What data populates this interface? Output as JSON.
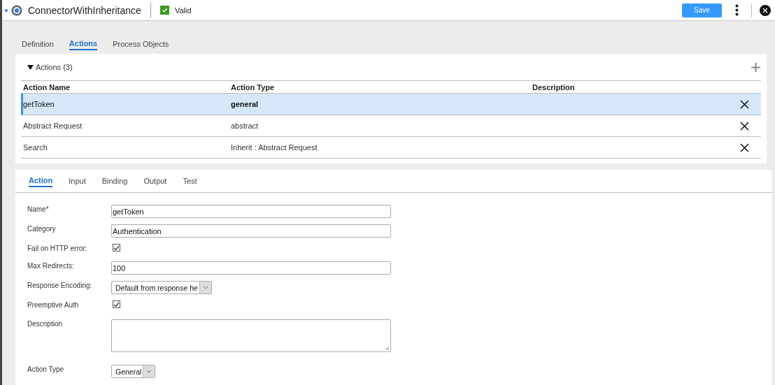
{
  "header": {
    "title": "ConnectorWithInheritance",
    "status": "Valid",
    "valid": true,
    "save": "Save"
  },
  "tabs": [
    {
      "label": "Definition",
      "selected": false
    },
    {
      "label": "Actions",
      "selected": true
    },
    {
      "label": "Process Objects",
      "selected": false
    }
  ],
  "actions": {
    "heading": "Actions (3)",
    "expanded": true,
    "columns": [
      "Action Name",
      "Action Type",
      "Description"
    ],
    "rows": [
      {
        "name": "getToken",
        "type": "general",
        "selected": true
      },
      {
        "name": "Abstract Request",
        "type": "abstract",
        "selected": false
      },
      {
        "name": "Search",
        "type": "Inherit : Abstract Request",
        "selected": false
      }
    ]
  },
  "detail_tabs": [
    {
      "label": "Action",
      "selected": true
    },
    {
      "label": "Input",
      "selected": false
    },
    {
      "label": "Binding",
      "selected": false
    },
    {
      "label": "Output",
      "selected": false
    },
    {
      "label": "Test",
      "selected": false
    }
  ],
  "form": [
    {
      "kind": "text",
      "label": "Name*",
      "value": "getToken"
    },
    {
      "kind": "text",
      "label": "Category",
      "value": "Authentication"
    },
    {
      "kind": "checkbox",
      "label": "Fail on HTTP error:",
      "checked": true
    },
    {
      "kind": "text",
      "label": "Max Redirects:",
      "value": "100"
    },
    {
      "kind": "select",
      "label": "Response Encoding:",
      "value": "Default from response he"
    },
    {
      "kind": "checkbox",
      "label": "Preemptive Auth",
      "checked": true
    },
    {
      "kind": "textarea",
      "label": "Description"
    },
    {
      "kind": "select",
      "label": "Action Type",
      "value": "General"
    }
  ]
}
